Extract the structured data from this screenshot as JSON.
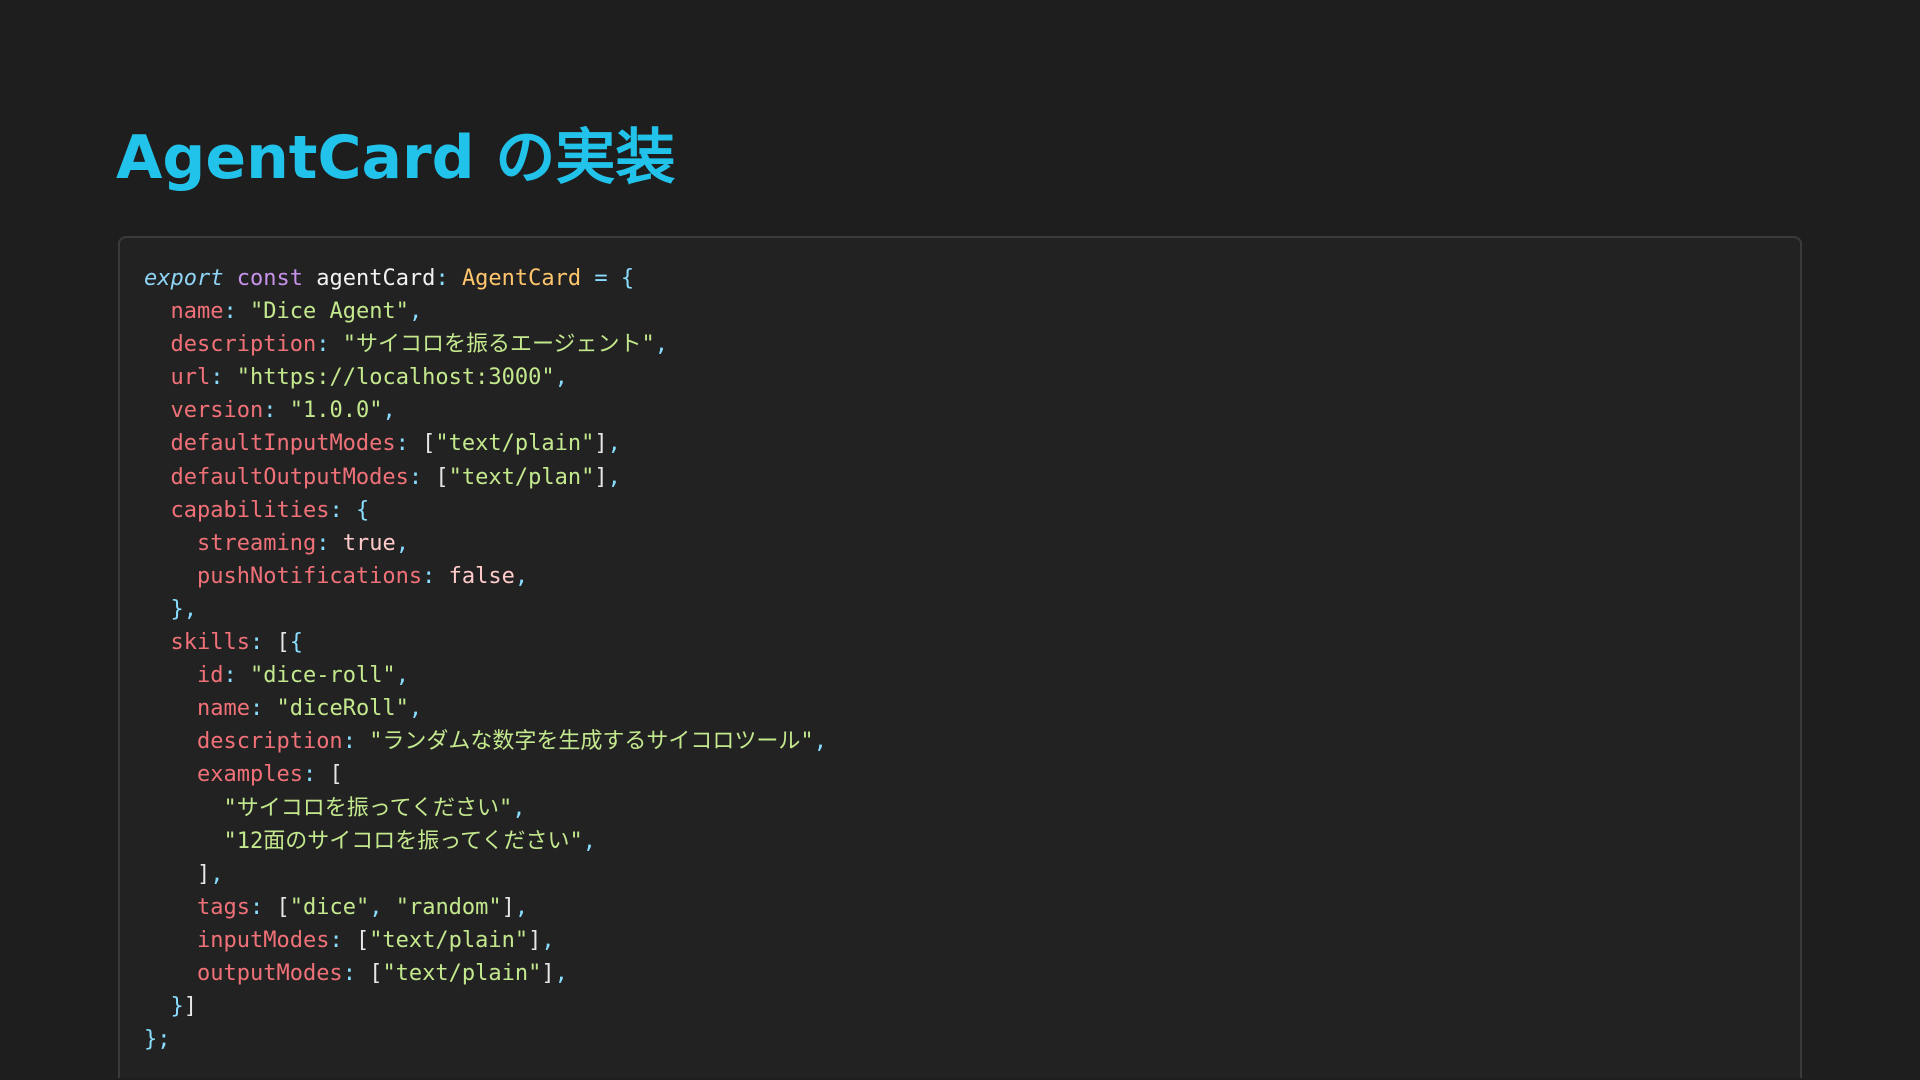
{
  "slide": {
    "title": "AgentCard の実装"
  },
  "code": {
    "language": "typescript",
    "colors": {
      "background": "#1e1e1e",
      "block": "#222222",
      "title": "#22c3ea",
      "keyword": "#8fd3f5",
      "property": "#f07178",
      "string": "#c3e88d",
      "type": "#ffc66d",
      "punctuation": "#89ddff"
    },
    "lines": [
      [
        [
          "kw",
          "export"
        ],
        [
          "plain",
          " "
        ],
        [
          "kw2",
          "const"
        ],
        [
          "plain",
          " "
        ],
        [
          "ident",
          "agentCard"
        ],
        [
          "punc",
          ":"
        ],
        [
          "plain",
          " "
        ],
        [
          "type",
          "AgentCard"
        ],
        [
          "plain",
          " "
        ],
        [
          "punc",
          "="
        ],
        [
          "plain",
          " "
        ],
        [
          "punc",
          "{"
        ]
      ],
      [
        [
          "plain",
          "  "
        ],
        [
          "prop",
          "name"
        ],
        [
          "punc",
          ":"
        ],
        [
          "plain",
          " "
        ],
        [
          "str",
          "\"Dice Agent\""
        ],
        [
          "punc",
          ","
        ]
      ],
      [
        [
          "plain",
          "  "
        ],
        [
          "prop",
          "description"
        ],
        [
          "punc",
          ":"
        ],
        [
          "plain",
          " "
        ],
        [
          "str",
          "\"サイコロを振るエージェント\""
        ],
        [
          "punc",
          ","
        ]
      ],
      [
        [
          "plain",
          "  "
        ],
        [
          "prop",
          "url"
        ],
        [
          "punc",
          ":"
        ],
        [
          "plain",
          " "
        ],
        [
          "str",
          "\"https://localhost:3000\""
        ],
        [
          "punc",
          ","
        ]
      ],
      [
        [
          "plain",
          "  "
        ],
        [
          "prop",
          "version"
        ],
        [
          "punc",
          ":"
        ],
        [
          "plain",
          " "
        ],
        [
          "str",
          "\"1.0.0\""
        ],
        [
          "punc",
          ","
        ]
      ],
      [
        [
          "plain",
          "  "
        ],
        [
          "prop",
          "defaultInputModes"
        ],
        [
          "punc",
          ":"
        ],
        [
          "plain",
          " "
        ],
        [
          "plain",
          "["
        ],
        [
          "str",
          "\"text/plain\""
        ],
        [
          "plain",
          "]"
        ],
        [
          "punc",
          ","
        ]
      ],
      [
        [
          "plain",
          "  "
        ],
        [
          "prop",
          "defaultOutputModes"
        ],
        [
          "punc",
          ":"
        ],
        [
          "plain",
          " "
        ],
        [
          "plain",
          "["
        ],
        [
          "str",
          "\"text/plan\""
        ],
        [
          "plain",
          "]"
        ],
        [
          "punc",
          ","
        ]
      ],
      [
        [
          "plain",
          "  "
        ],
        [
          "prop",
          "capabilities"
        ],
        [
          "punc",
          ":"
        ],
        [
          "plain",
          " "
        ],
        [
          "punc",
          "{"
        ]
      ],
      [
        [
          "plain",
          "    "
        ],
        [
          "prop",
          "streaming"
        ],
        [
          "punc",
          ":"
        ],
        [
          "plain",
          " "
        ],
        [
          "val",
          "true"
        ],
        [
          "punc",
          ","
        ]
      ],
      [
        [
          "plain",
          "    "
        ],
        [
          "prop",
          "pushNotifications"
        ],
        [
          "punc",
          ":"
        ],
        [
          "plain",
          " "
        ],
        [
          "val",
          "false"
        ],
        [
          "punc",
          ","
        ]
      ],
      [
        [
          "plain",
          "  "
        ],
        [
          "punc",
          "},"
        ]
      ],
      [
        [
          "plain",
          "  "
        ],
        [
          "prop",
          "skills"
        ],
        [
          "punc",
          ":"
        ],
        [
          "plain",
          " "
        ],
        [
          "plain",
          "["
        ],
        [
          "punc",
          "{"
        ]
      ],
      [
        [
          "plain",
          "    "
        ],
        [
          "prop",
          "id"
        ],
        [
          "punc",
          ":"
        ],
        [
          "plain",
          " "
        ],
        [
          "str",
          "\"dice-roll\""
        ],
        [
          "punc",
          ","
        ]
      ],
      [
        [
          "plain",
          "    "
        ],
        [
          "prop",
          "name"
        ],
        [
          "punc",
          ":"
        ],
        [
          "plain",
          " "
        ],
        [
          "str",
          "\"diceRoll\""
        ],
        [
          "punc",
          ","
        ]
      ],
      [
        [
          "plain",
          "    "
        ],
        [
          "prop",
          "description"
        ],
        [
          "punc",
          ":"
        ],
        [
          "plain",
          " "
        ],
        [
          "str",
          "\"ランダムな数字を生成するサイコロツール\""
        ],
        [
          "punc",
          ","
        ]
      ],
      [
        [
          "plain",
          "    "
        ],
        [
          "prop",
          "examples"
        ],
        [
          "punc",
          ":"
        ],
        [
          "plain",
          " "
        ],
        [
          "plain",
          "["
        ]
      ],
      [
        [
          "plain",
          "      "
        ],
        [
          "str",
          "\"サイコロを振ってください\""
        ],
        [
          "punc",
          ","
        ]
      ],
      [
        [
          "plain",
          "      "
        ],
        [
          "str",
          "\"12面のサイコロを振ってください\""
        ],
        [
          "punc",
          ","
        ]
      ],
      [
        [
          "plain",
          "    "
        ],
        [
          "plain",
          "]"
        ],
        [
          "punc",
          ","
        ]
      ],
      [
        [
          "plain",
          "    "
        ],
        [
          "prop",
          "tags"
        ],
        [
          "punc",
          ":"
        ],
        [
          "plain",
          " "
        ],
        [
          "plain",
          "["
        ],
        [
          "str",
          "\"dice\""
        ],
        [
          "punc",
          ","
        ],
        [
          "plain",
          " "
        ],
        [
          "str",
          "\"random\""
        ],
        [
          "plain",
          "]"
        ],
        [
          "punc",
          ","
        ]
      ],
      [
        [
          "plain",
          "    "
        ],
        [
          "prop",
          "inputModes"
        ],
        [
          "punc",
          ":"
        ],
        [
          "plain",
          " "
        ],
        [
          "plain",
          "["
        ],
        [
          "str",
          "\"text/plain\""
        ],
        [
          "plain",
          "]"
        ],
        [
          "punc",
          ","
        ]
      ],
      [
        [
          "plain",
          "    "
        ],
        [
          "prop",
          "outputModes"
        ],
        [
          "punc",
          ":"
        ],
        [
          "plain",
          " "
        ],
        [
          "plain",
          "["
        ],
        [
          "str",
          "\"text/plain\""
        ],
        [
          "plain",
          "]"
        ],
        [
          "punc",
          ","
        ]
      ],
      [
        [
          "plain",
          "  "
        ],
        [
          "punc",
          "}"
        ],
        [
          "plain",
          "]"
        ]
      ],
      [
        [
          "punc",
          "};"
        ]
      ]
    ]
  }
}
